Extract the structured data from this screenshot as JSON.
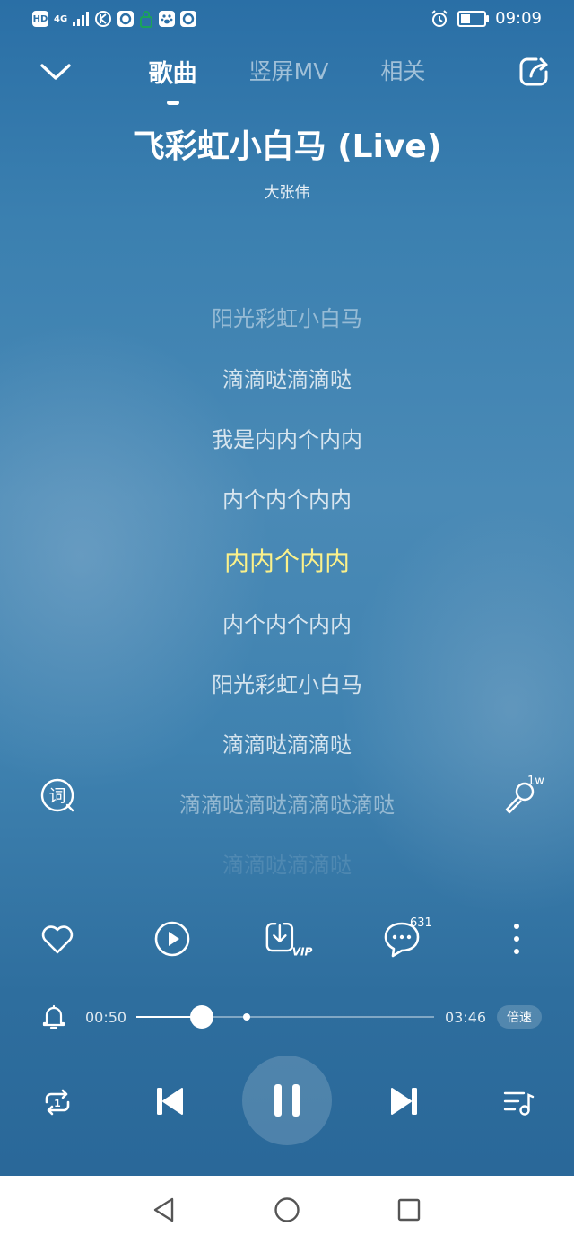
{
  "status_bar": {
    "signal_text": "HD",
    "network": "4G",
    "time": "09:09",
    "battery_level": 0.4
  },
  "header": {
    "tabs": [
      {
        "label": "歌曲",
        "active": true
      },
      {
        "label": "竖屏MV",
        "active": false
      },
      {
        "label": "相关",
        "active": false
      }
    ]
  },
  "song": {
    "title": "飞彩虹小白马 (Live)",
    "artist": "大张伟"
  },
  "lyrics": {
    "lines": [
      "阳光彩虹小白马",
      "滴滴哒滴滴哒",
      "我是内内个内内",
      "内个内个内内",
      "内内个内内",
      "内个内个内内",
      "阳光彩虹小白马",
      "滴滴哒滴滴哒",
      "滴滴哒滴哒滴滴哒滴哒",
      "滴滴哒滴滴哒"
    ],
    "current_index": 4
  },
  "side": {
    "karaoke_count": "1w"
  },
  "actions": {
    "comment_count": "631",
    "vip_label": "VIP"
  },
  "playback": {
    "elapsed": "00:50",
    "duration": "03:46",
    "progress": 0.221,
    "marker": 0.37,
    "speed_label": "倍速"
  },
  "colors": {
    "current_lyric": "#fbf18a",
    "background_top": "#2a6fa6",
    "background_mid": "#4a8ab6"
  }
}
